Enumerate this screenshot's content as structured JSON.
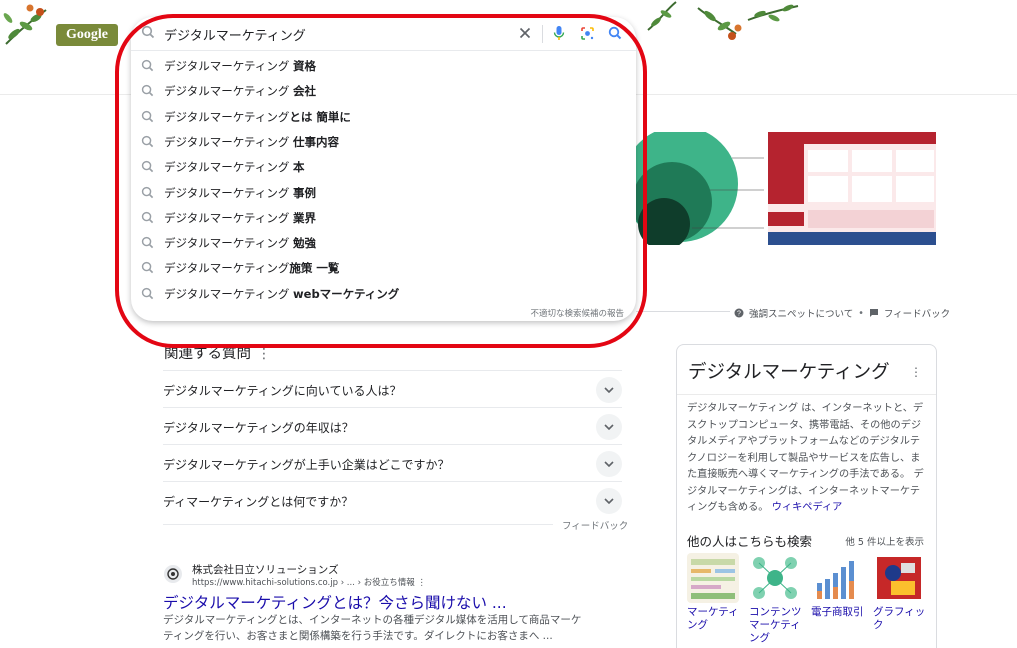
{
  "header": {
    "logo_text": "Google"
  },
  "search": {
    "query": "デジタルマーケティング",
    "clear_icon": "close-icon",
    "voice_icon": "microphone-icon",
    "lens_icon": "camera-lens-icon",
    "search_icon": "search-icon"
  },
  "suggestions": [
    {
      "prefix": "デジタルマーケティング ",
      "bold": "資格"
    },
    {
      "prefix": "デジタルマーケティング ",
      "bold": "会社"
    },
    {
      "prefix": "デジタルマーケティング",
      "bold": "とは 簡単に"
    },
    {
      "prefix": "デジタルマーケティング ",
      "bold": "仕事内容"
    },
    {
      "prefix": "デジタルマーケティング ",
      "bold": "本"
    },
    {
      "prefix": "デジタルマーケティング ",
      "bold": "事例"
    },
    {
      "prefix": "デジタルマーケティング ",
      "bold": "業界"
    },
    {
      "prefix": "デジタルマーケティング ",
      "bold": "勉強"
    },
    {
      "prefix": "デジタルマーケティング",
      "bold": "施策 一覧"
    },
    {
      "prefix": "デジタルマーケティング ",
      "bold": "webマーケティング"
    }
  ],
  "report_link": "不適切な検索候補の報告",
  "snippet_meta": {
    "about": "強調スニペットについて",
    "dot": "•",
    "feedback": "フィードバック"
  },
  "related": {
    "title": "関連する質問",
    "more": "⋮",
    "questions": [
      "デジタルマーケティングに向いている人は？",
      "デジタルマーケティングの年収は？",
      "デジタルマーケティングが上手い企業はどこですか？",
      "ディマーケティングとは何ですか？"
    ],
    "feedback": "フィードバック"
  },
  "result": {
    "site": "株式会社日立ソリューションズ",
    "url": "https://www.hitachi-solutions.co.jp › ... › お役立ち情報",
    "more": "⋮",
    "title": "デジタルマーケティングとは？今さら聞けない ...",
    "desc": "デジタルマーケティングとは、インターネットの各種デジタル媒体を活用して商品マーケティングを行い、お客さまと関係構築を行う手法です。ダイレクトにお客さまへ ..."
  },
  "knowledge_panel": {
    "title": "デジタルマーケティング",
    "dots": "⋮",
    "description": "デジタルマーケティング は、インターネットと、デスクトップコンピュータ、携帯電話、その他のデジタルメディアやプラットフォームなどのデジタルテクノロジーを利用して製品やサービスを広告し、また直接販売へ導くマーケティングの手法である。 デジタルマーケティングは、インターネットマーケティングも含める。",
    "wiki_link": "ウィキペディア",
    "also_search": "他の人はこちらも検索",
    "more_link": "他 5 件以上を表示",
    "cards": [
      {
        "label": "マーケティング"
      },
      {
        "label": "コンテンツマーケティング"
      },
      {
        "label": "電子商取引"
      },
      {
        "label": "グラフィック"
      }
    ]
  },
  "colors": {
    "annotation_ring": "#e30613",
    "link": "#1a0dab",
    "venn_outer": "#3eb489",
    "venn_mid": "#1f7a57",
    "venn_inner": "#0f3d2b",
    "table_header": "#b5232f"
  }
}
